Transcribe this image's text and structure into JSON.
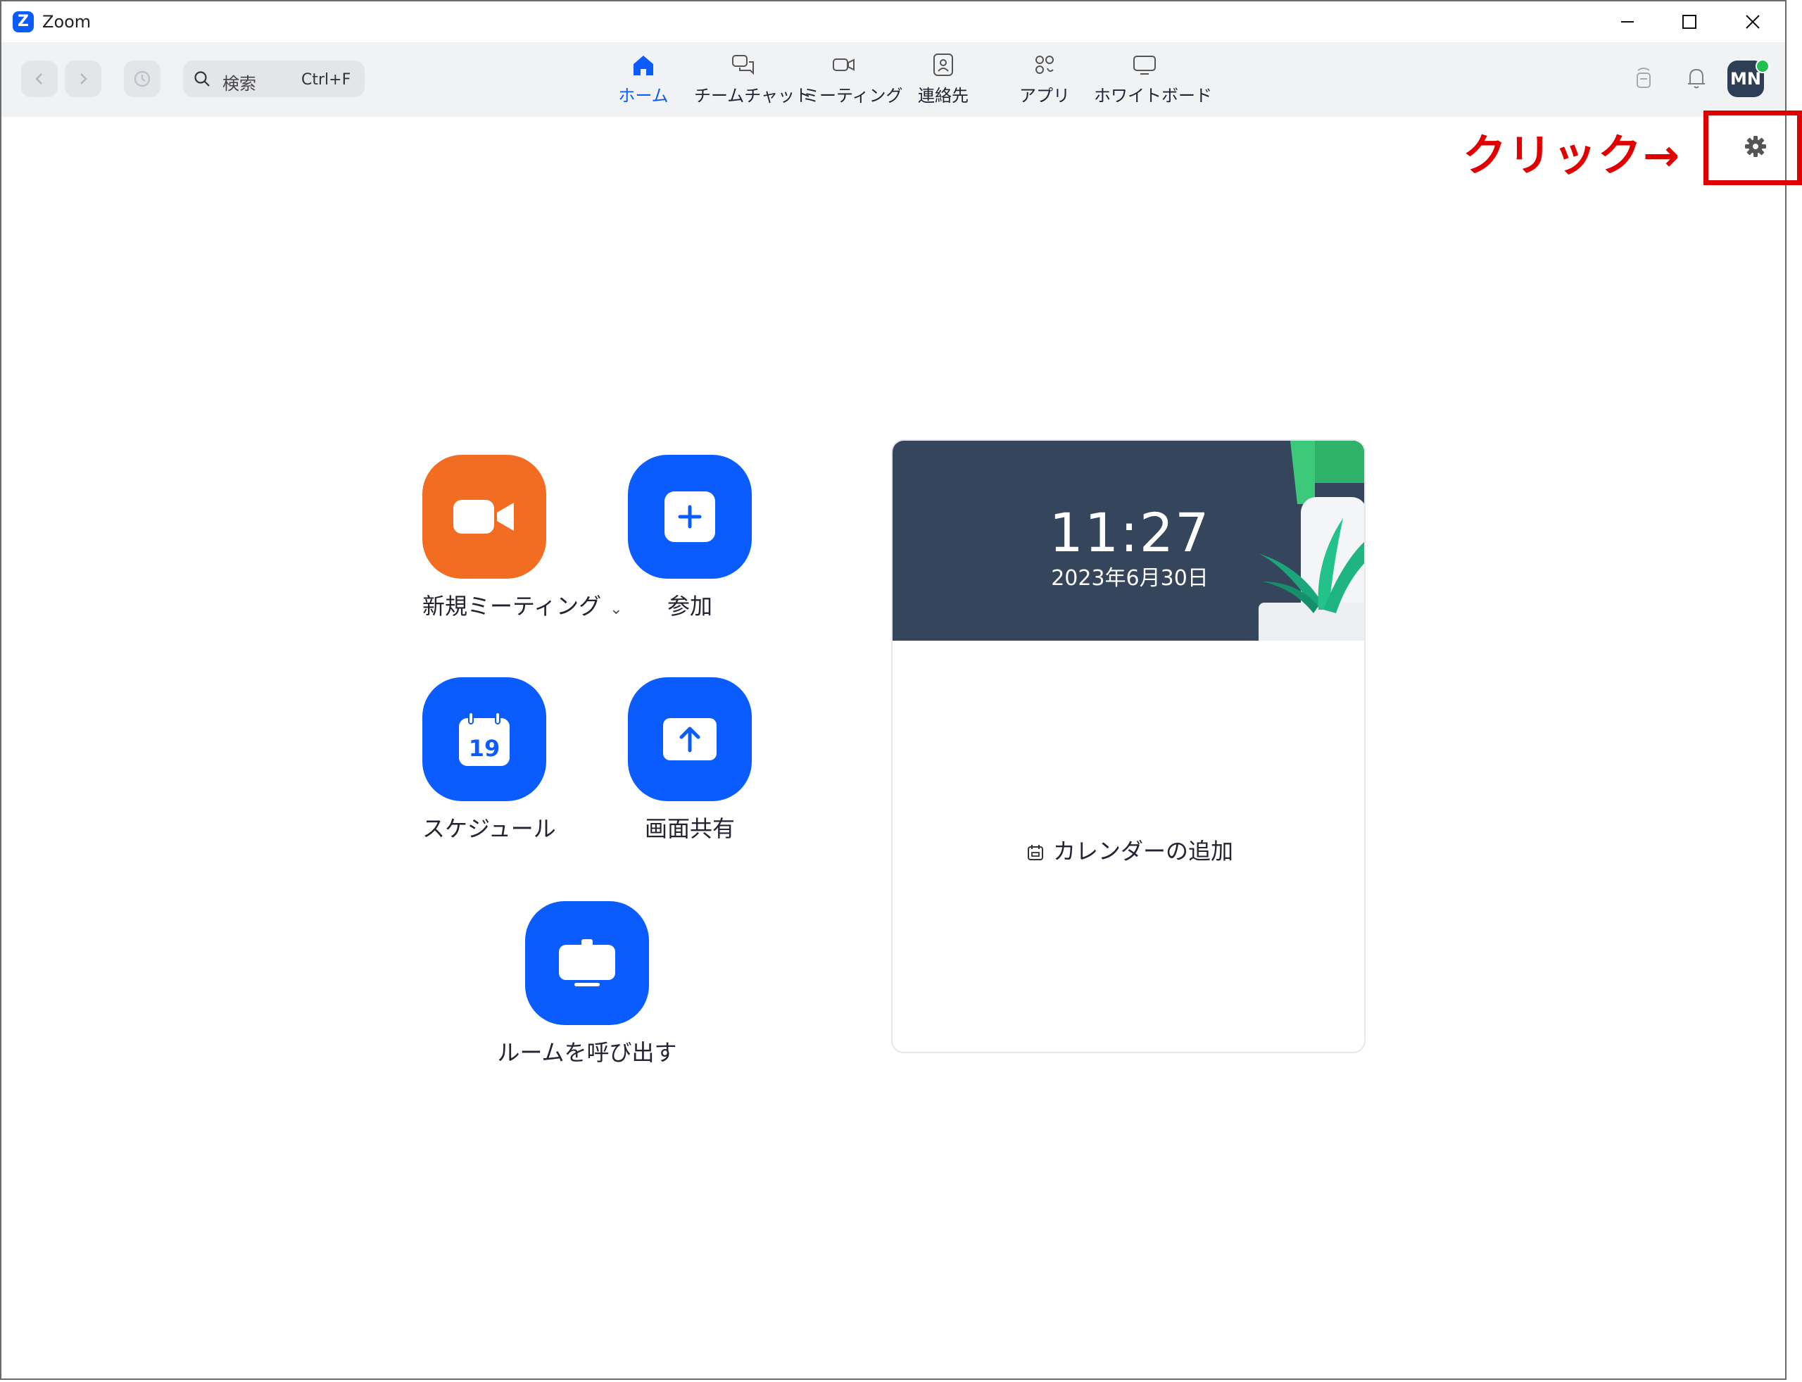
{
  "window": {
    "title": "Zoom",
    "app_logo_letter": "Z"
  },
  "search": {
    "placeholder": "検索",
    "shortcut": "Ctrl+F"
  },
  "tabs": [
    {
      "label": "ホーム",
      "icon": "home-icon",
      "active": true
    },
    {
      "label": "チームチャット",
      "icon": "chat-icon",
      "active": false
    },
    {
      "label": "ミーティング",
      "icon": "video-icon",
      "active": false
    },
    {
      "label": "連絡先",
      "icon": "contacts-icon",
      "active": false
    },
    {
      "label": "アプリ",
      "icon": "apps-icon",
      "active": false
    },
    {
      "label": "ホワイトボード",
      "icon": "whiteboard-icon",
      "active": false
    }
  ],
  "user": {
    "initials": "MN",
    "status": "online"
  },
  "annotation": {
    "text": "クリック→",
    "color": "#e00000"
  },
  "actions": {
    "new_meeting": "新規ミーティング",
    "join": "参加",
    "schedule": "スケジュール",
    "schedule_day": "19",
    "share_screen": "画面共有",
    "call_room": "ルームを呼び出す"
  },
  "calendar": {
    "time": "11:27",
    "date": "2023年6月30日",
    "add_label": "カレンダーの追加"
  },
  "colors": {
    "accent": "#0b5cff",
    "orange": "#f26d21",
    "card_header": "#34455c",
    "toolbar": "#f1f2f4",
    "online": "#1fc04d"
  }
}
